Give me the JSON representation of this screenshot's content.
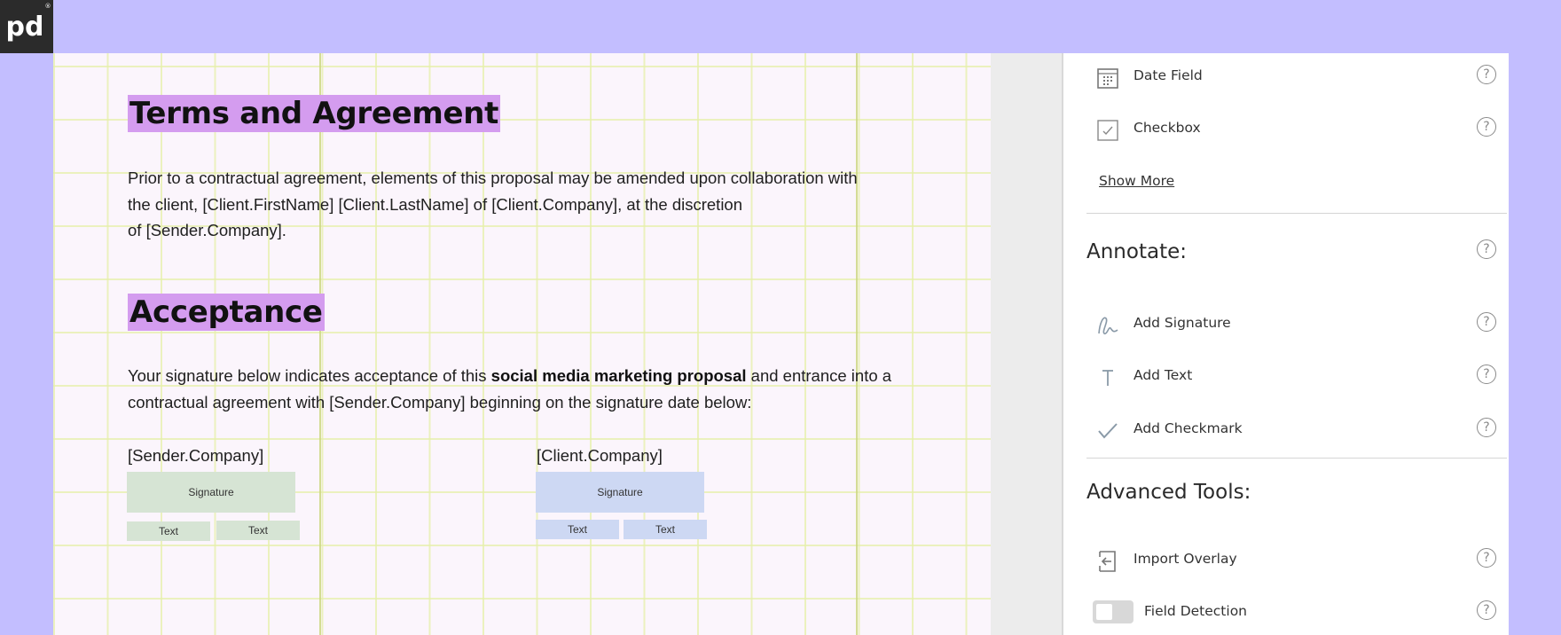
{
  "logo": {
    "text": "pd",
    "mark": "®"
  },
  "document": {
    "terms_heading": "Terms and Agreement",
    "terms_line1": "Prior to a contractual agreement, elements of this proposal may be amended upon collaboration with",
    "terms_line2": "the client, [Client.FirstName] [Client.LastName] of [Client.Company], at the discretion",
    "terms_line3": "of [Sender.Company].",
    "acceptance_heading": "Acceptance",
    "acceptance_line1_a": "Your signature below indicates acceptance of this ",
    "acceptance_line1_bold": "social media marketing proposal",
    "acceptance_line1_b": " and entrance into a",
    "acceptance_line2": "contractual agreement with [Sender.Company] beginning on the signature date below:",
    "sender": {
      "party": "[Sender.Company]",
      "signature": "Signature",
      "text1": "Text",
      "text2": "Text"
    },
    "client": {
      "party": "[Client.Company]",
      "signature": "Signature",
      "text1": "Text",
      "text2": "Text"
    }
  },
  "panel": {
    "fields": [
      {
        "label": "Date Field",
        "icon": "calendar-icon"
      },
      {
        "label": "Checkbox",
        "icon": "checkbox-icon"
      }
    ],
    "show_more": "Show More",
    "annotate": {
      "title": "Annotate:",
      "items": [
        {
          "label": "Add Signature",
          "icon": "signature-icon"
        },
        {
          "label": "Add Text",
          "icon": "text-icon"
        },
        {
          "label": "Add Checkmark",
          "icon": "checkmark-icon"
        }
      ]
    },
    "advanced": {
      "title": "Advanced Tools:",
      "items": [
        {
          "label": "Import Overlay",
          "icon": "import-icon"
        },
        {
          "label": "Field Detection",
          "icon": "toggle-switch"
        }
      ]
    },
    "help_glyph": "?"
  },
  "colors": {
    "background": "#c3beff",
    "heading_highlight": "#d49cef",
    "sender_fields": "#d6e4d4",
    "client_fields": "#cdd8f3"
  }
}
